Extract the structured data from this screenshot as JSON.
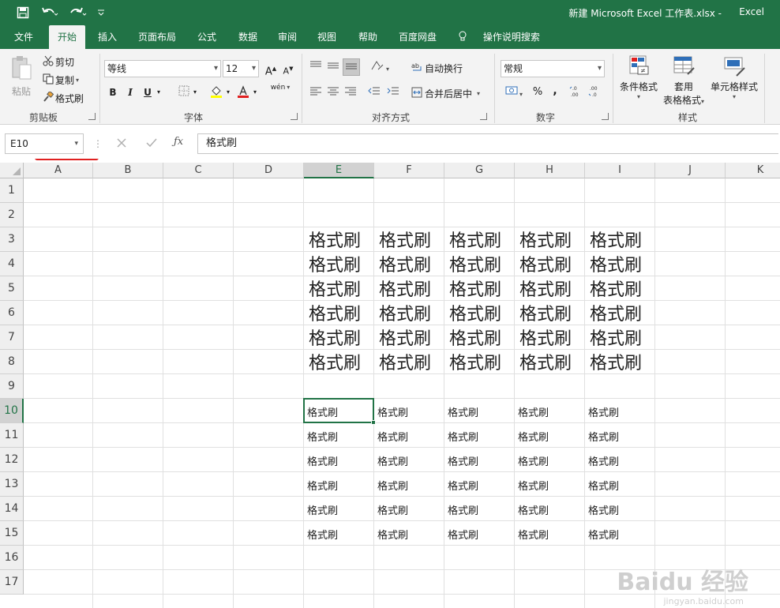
{
  "titlebar": {
    "doc_title": "新建 Microsoft Excel 工作表.xlsx  -",
    "app_name": "Excel",
    "save_icon": "save-icon",
    "undo_icon": "undo-icon",
    "redo_icon": "redo-icon",
    "customize_icon": "customize-qat-icon"
  },
  "tabs": [
    "文件",
    "开始",
    "插入",
    "页面布局",
    "公式",
    "数据",
    "审阅",
    "视图",
    "帮助",
    "百度网盘"
  ],
  "active_tab": "开始",
  "tell_me": "操作说明搜索",
  "ribbon": {
    "clipboard": {
      "paste": "粘贴",
      "cut": "剪切",
      "copy": "复制",
      "format_painter": "格式刷",
      "label": "剪贴板"
    },
    "font": {
      "font_name": "等线",
      "font_size": "12",
      "bold": "B",
      "italic": "I",
      "underline": "U",
      "label": "字体",
      "grow": "A",
      "shrink": "A",
      "wen": "wén"
    },
    "alignment": {
      "wrap_text": "自动换行",
      "merge_center": "合并后居中",
      "label": "对齐方式"
    },
    "number": {
      "format": "常规",
      "percent": "%",
      "comma": ",",
      "label": "数字"
    },
    "styles": {
      "conditional": "条件格式",
      "table_format_line1": "套用",
      "table_format_line2": "表格格式",
      "cell_styles": "单元格样式",
      "label": "样式"
    }
  },
  "formula_bar": {
    "name_box": "E10",
    "content": "格式刷"
  },
  "columns": [
    "A",
    "B",
    "C",
    "D",
    "E",
    "F",
    "G",
    "H",
    "I",
    "J",
    "K"
  ],
  "rows": [
    "1",
    "2",
    "3",
    "4",
    "5",
    "6",
    "7",
    "8",
    "9",
    "10",
    "11",
    "12",
    "13",
    "14",
    "15",
    "16",
    "17"
  ],
  "selected_column": "E",
  "selected_row": "10",
  "cell_text": "格式刷",
  "big_block": {
    "rows": [
      "3",
      "4",
      "5",
      "6",
      "7",
      "8"
    ],
    "cols": [
      "E",
      "F",
      "G",
      "H",
      "I"
    ]
  },
  "small_block": {
    "rows": [
      "10",
      "11",
      "12",
      "13",
      "14",
      "15"
    ],
    "cols": [
      "E",
      "F",
      "G",
      "H",
      "I"
    ]
  },
  "watermark": {
    "main": "Baidu 经验",
    "sub": "jingyan.baidu.com"
  },
  "colors": {
    "accent": "#217346",
    "highlight": "#e02020"
  }
}
